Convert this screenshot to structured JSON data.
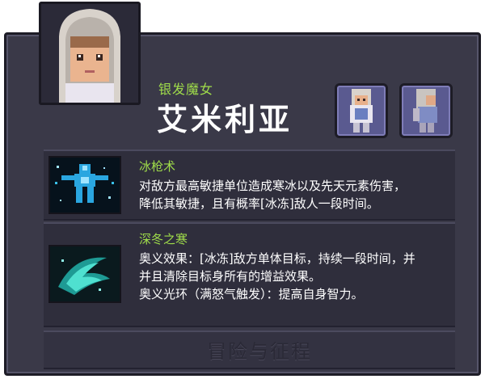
{
  "hero": {
    "subtitle": "银发魔女",
    "name": "艾米利亚"
  },
  "skills": [
    {
      "name": "冰枪术",
      "desc": [
        "对敌方最高敏捷单位造成寒冰以及先天元素伤害，",
        "降低其敏捷，且有概率[冰冻]敌人一段时间。"
      ],
      "icon": "ice-spear-icon"
    },
    {
      "name": "深冬之寒",
      "desc": [
        "奥义效果：[冰冻]敌方单体目标，持续一段时间，并",
        "并且清除目标身所有的增益效果。",
        "奥义光环（满怒气触发）：提高自身智力。"
      ],
      "icon": "winter-chill-icon"
    }
  ],
  "watermark": "冒险与征程",
  "colors": {
    "accent_green": "#9fdc4a",
    "panel": "#3a3948",
    "frame": "#6b68a8"
  }
}
